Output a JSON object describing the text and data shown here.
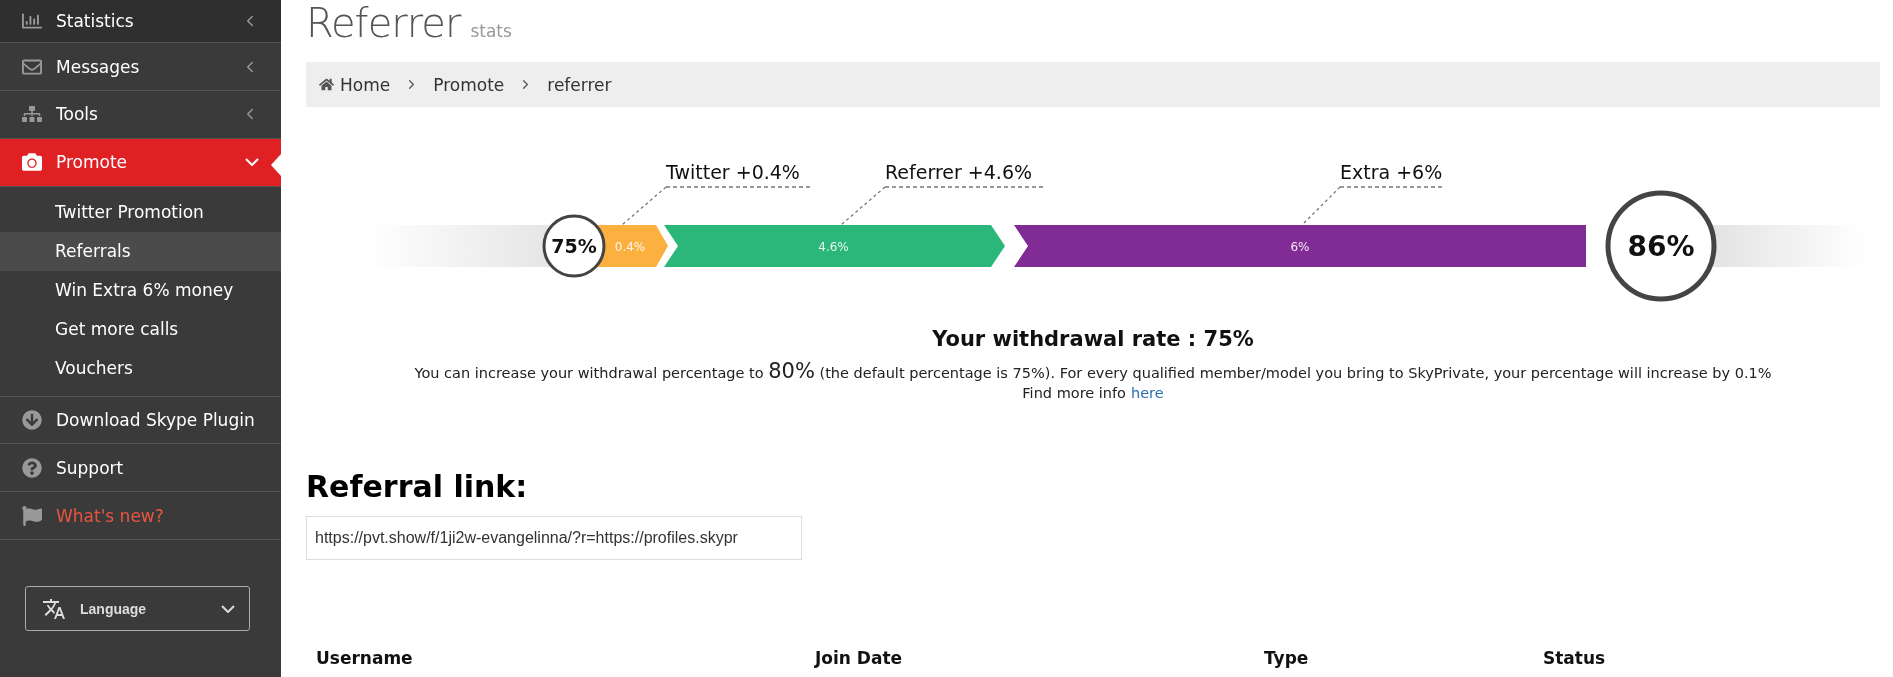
{
  "sidebar": {
    "items": [
      {
        "label": "Statistics",
        "kind": "menu",
        "expanded": false,
        "selected": false
      },
      {
        "label": "Messages",
        "kind": "menu",
        "expanded": false,
        "selected": false
      },
      {
        "label": "Tools",
        "kind": "menu",
        "expanded": false,
        "selected": false
      },
      {
        "label": "Promote",
        "kind": "menu",
        "expanded": true,
        "selected": true,
        "children": [
          {
            "label": "Twitter Promotion",
            "selected": false
          },
          {
            "label": "Referrals",
            "selected": true
          },
          {
            "label": "Win Extra 6% money",
            "selected": false
          },
          {
            "label": "Get more calls",
            "selected": false
          },
          {
            "label": "Vouchers",
            "selected": false
          }
        ]
      },
      {
        "label": "Download Skype Plugin",
        "kind": "link",
        "selected": false
      },
      {
        "label": "Support",
        "kind": "link",
        "selected": false
      },
      {
        "label": "What's new?",
        "kind": "news",
        "selected": false
      }
    ],
    "language": {
      "label": "Language"
    }
  },
  "page": {
    "title": "Referrer",
    "subtitle": "stats"
  },
  "breadcrumb": [
    "Home",
    "Promote",
    "referrer"
  ],
  "withdrawal_bar": {
    "start": "75%",
    "end": "86%",
    "segments": [
      {
        "label": "Twitter +0.4%",
        "value": "0.4%",
        "color": "#fbb040"
      },
      {
        "label": "Referrer +4.6%",
        "value": "4.6%",
        "color": "#2bb77a"
      },
      {
        "label": "Extra +6%",
        "value": "6%",
        "color": "#812b95"
      }
    ]
  },
  "rate": {
    "heading": "Your withdrawal rate : 75%",
    "text_before": "You can increase your withdrawal percentage to",
    "highlight": "80%",
    "text_after": "(the default percentage is 75%). For every qualified member/model you bring to SkyPrivate, your percentage will increase by 0.1%",
    "info": "Find more info",
    "link": "here"
  },
  "referral": {
    "heading": "Referral link:",
    "value": "https://pvt.show/f/1ji2w-evangelinna/?r=https://profiles.skypr"
  },
  "table": {
    "columns": [
      "Username",
      "Join Date",
      "Type",
      "Status"
    ]
  }
}
